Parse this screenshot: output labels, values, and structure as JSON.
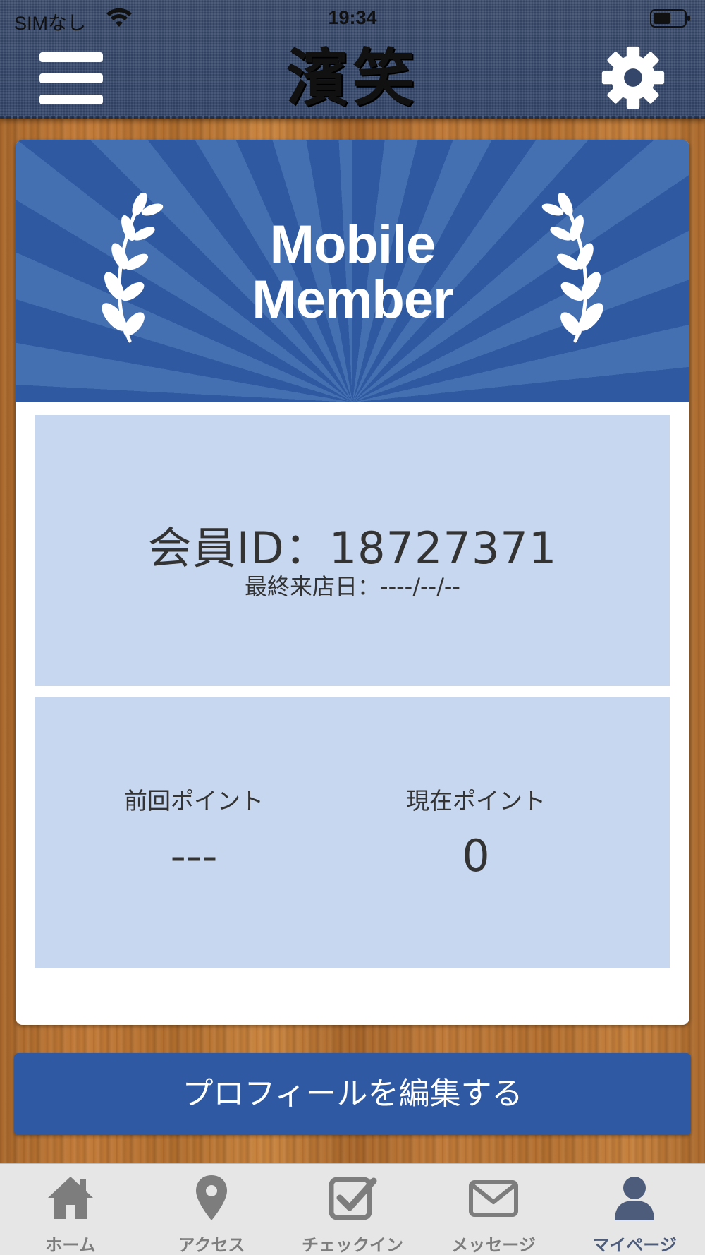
{
  "status_bar": {
    "carrier": "SIMなし",
    "time": "19:34"
  },
  "header": {
    "logo_text": "濱笑",
    "menu_icon": "hamburger-menu-icon",
    "settings_icon": "gear-icon"
  },
  "banner": {
    "title_line1": "Mobile",
    "title_line2": "Member"
  },
  "member": {
    "id_text": "会員ID：18727371",
    "last_visit_text": "最終来店日：----/--/--"
  },
  "points": {
    "previous_label": "前回ポイント",
    "previous_value": "---",
    "current_label": "現在ポイント",
    "current_value": "0"
  },
  "edit_button_label": "プロフィールを編集する",
  "tabs": [
    {
      "label": "ホーム",
      "icon": "home-icon",
      "active": false
    },
    {
      "label": "アクセス",
      "icon": "map-pin-icon",
      "active": false
    },
    {
      "label": "チェックイン",
      "icon": "checkbox-icon",
      "active": false
    },
    {
      "label": "メッセージ",
      "icon": "envelope-icon",
      "active": false
    },
    {
      "label": "マイページ",
      "icon": "user-icon",
      "active": true
    }
  ],
  "colors": {
    "header_bg": "#34466a",
    "banner_blue": "#2f59a0",
    "panel_bg": "#c8d7f0",
    "button_bg": "#2f5aa3",
    "tab_active": "#4d5c7a",
    "tab_inactive": "#7d7d7d"
  }
}
